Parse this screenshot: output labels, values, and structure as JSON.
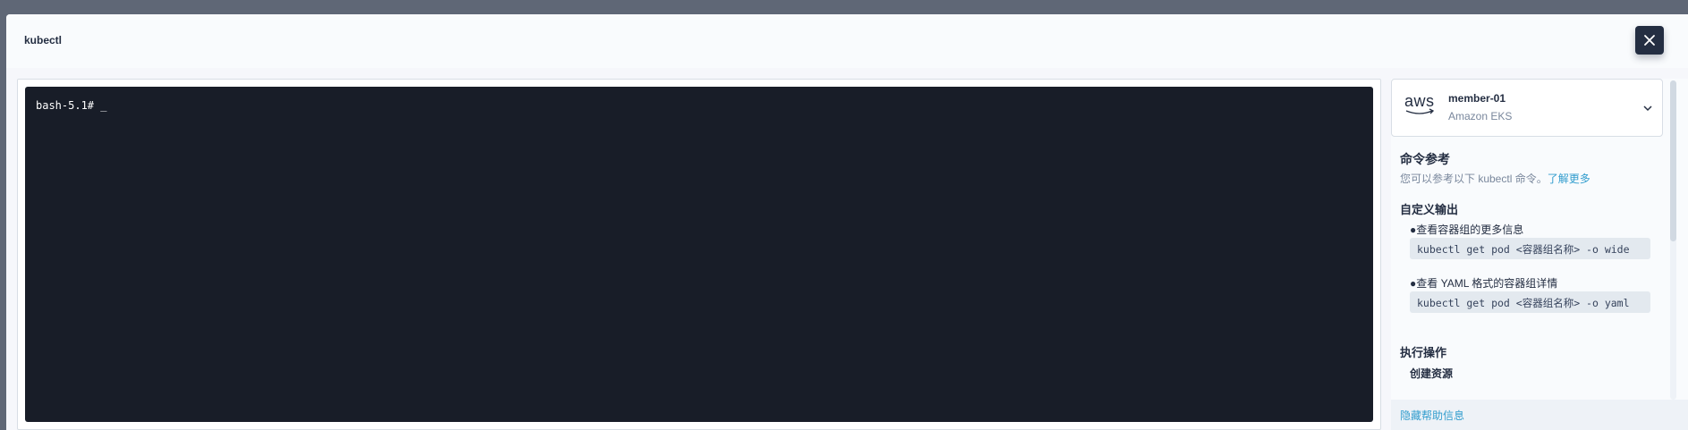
{
  "modal": {
    "title": "kubectl"
  },
  "terminal": {
    "prompt": "bash-5.1# _"
  },
  "cluster": {
    "logo_text": "aws",
    "name": "member-01",
    "provider": "Amazon EKS"
  },
  "help": {
    "title": "命令参考",
    "description": "您可以参考以下 kubectl 命令。",
    "learn_more": "了解更多",
    "sections": [
      {
        "title": "自定义输出",
        "items": [
          {
            "label": "●查看容器组的更多信息",
            "command": "kubectl get pod <容器组名称> -o wide"
          },
          {
            "label": "●查看 YAML 格式的容器组详情",
            "command": "kubectl get pod <容器组名称> -o yaml"
          }
        ]
      },
      {
        "title": "执行操作",
        "sub_items": [
          "创建资源"
        ]
      }
    ],
    "hide_label": "隐藏帮助信息"
  },
  "colors": {
    "terminal_bg": "#181d28",
    "accent": "#329dce",
    "dark": "#242e42"
  }
}
